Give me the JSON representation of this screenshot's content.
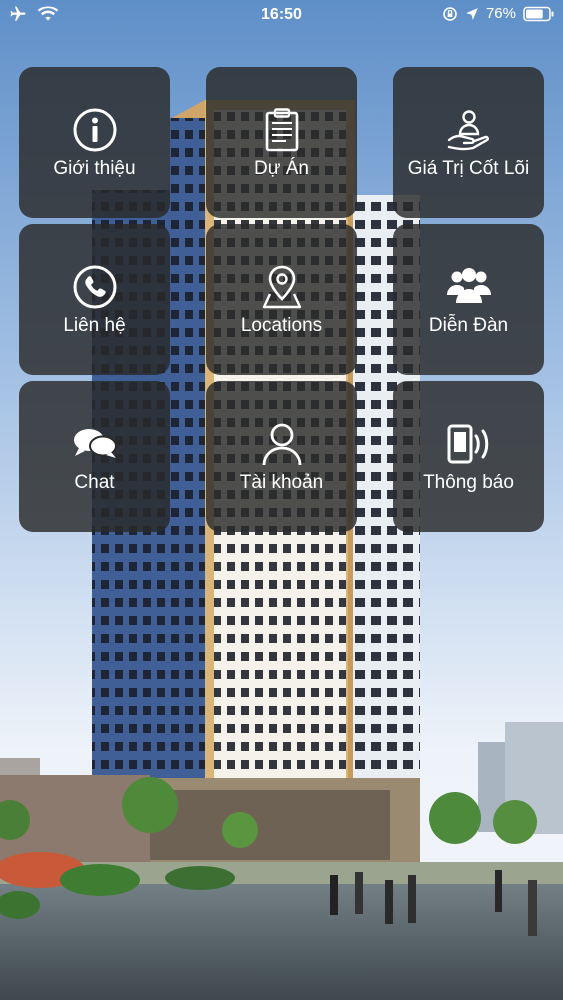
{
  "status_bar": {
    "time": "16:50",
    "battery_percent": "76%",
    "battery_level": 0.76,
    "left_icons": [
      "airplane-icon",
      "wifi-icon"
    ],
    "right_icons": [
      "rotation-lock-icon",
      "location-arrow-icon",
      "battery-icon"
    ]
  },
  "menu": {
    "tiles": [
      {
        "label": "Giới thiệu",
        "icon": "info-icon"
      },
      {
        "label": "Dự Án",
        "icon": "clipboard-icon"
      },
      {
        "label": "Giá Trị Cốt Lõi",
        "icon": "hand-person-icon"
      },
      {
        "label": "Liên hệ",
        "icon": "phone-icon"
      },
      {
        "label": "Locations",
        "icon": "map-pin-icon"
      },
      {
        "label": "Diễn Đàn",
        "icon": "people-icon"
      },
      {
        "label": "Chat",
        "icon": "chat-bubbles-icon"
      },
      {
        "label": "Tài khoản",
        "icon": "user-icon"
      },
      {
        "label": "Thông báo",
        "icon": "phone-vibrate-icon"
      }
    ]
  },
  "colors": {
    "tile_background": "#2a2a2a",
    "sky_top": "#5f8fc8",
    "sky_bottom": "#eef3fa",
    "text": "#ffffff"
  }
}
